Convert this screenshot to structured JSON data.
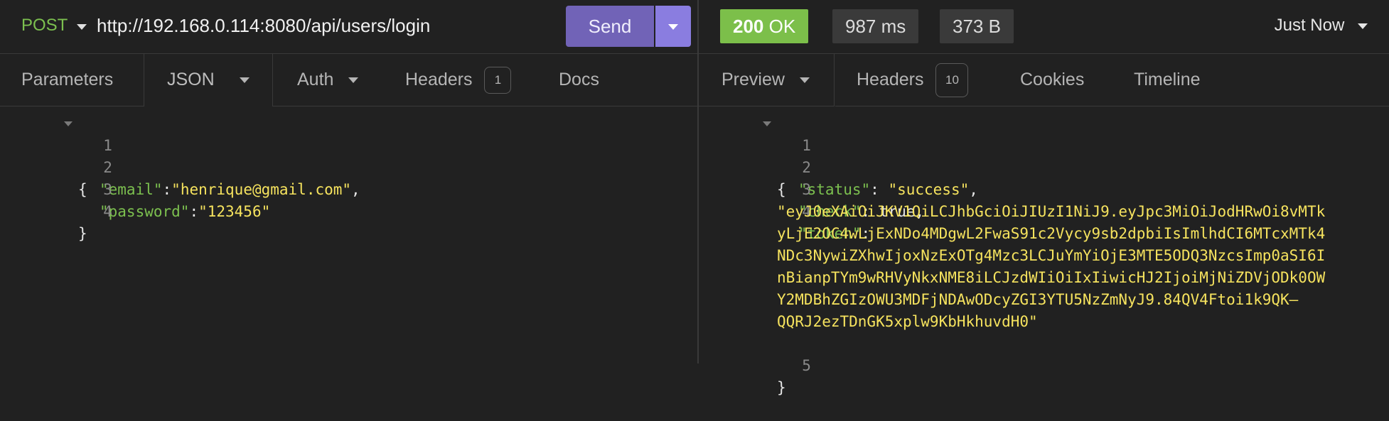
{
  "request": {
    "method": "POST",
    "url": "http://192.168.0.114:8080/api/users/login",
    "send_label": "Send",
    "tabs": [
      {
        "label": "Parameters"
      },
      {
        "label": "JSON"
      },
      {
        "label": "Auth"
      },
      {
        "label": "Headers",
        "badge": "1"
      },
      {
        "label": "Docs"
      }
    ],
    "body_lines": [
      {
        "num": "1",
        "text": "{"
      },
      {
        "num": "2",
        "key": "\"email\"",
        "sep": ":",
        "value": "\"henrique@gmail.com\"",
        "end": ","
      },
      {
        "num": "3",
        "key": "\"password\"",
        "sep": ":",
        "value": "\"123456\"",
        "end": ""
      },
      {
        "num": "4",
        "text": "}"
      }
    ]
  },
  "response": {
    "status_code": "200",
    "status_text": "OK",
    "time": "987 ms",
    "size": "373 B",
    "history_label": "Just Now",
    "status_color": "#7cbf4a",
    "tabs": [
      {
        "label": "Preview"
      },
      {
        "label": "Headers",
        "badge": "10"
      },
      {
        "label": "Cookies"
      },
      {
        "label": "Timeline"
      }
    ],
    "body_lines": [
      {
        "num": "1",
        "text": "{"
      },
      {
        "num": "2",
        "key": "\"status\"",
        "sep": ": ",
        "value": "\"success\"",
        "end": ","
      },
      {
        "num": "3",
        "key": "\"check\"",
        "sep": ": ",
        "value": "true",
        "end": ","
      },
      {
        "num": "4",
        "key": "\"token\"",
        "sep": ":"
      },
      {
        "num": "5",
        "text": "}"
      }
    ],
    "token_lines": [
      "\"eyJ0eXAiOiJKV1QiLCJhbGciOiJIUzI1NiJ9.eyJpc3MiOiJodHRwOi8vMTk",
      "yLjE2OC4wLjExNDo4MDgwL2FwaS91c2Vycy9sb2dpbiIsImlhdCI6MTcxMTk4",
      "NDc3NywiZXhwIjoxNzExOTg4Mzc3LCJuYmYiOjE3MTE5ODQ3NzcsImp0aSI6I",
      "nBianpTYm9wRHVyNkxNME8iLCJzdWIiOiIxIiwicHJ2IjoiMjNiZDVjODk0OW",
      "Y2MDBhZGIzOWU3MDFjNDAwODcyZGI3YTU5NzZmNyJ9.84QV4Ftoi1k9QK–",
      "QQRJ2ezTDnGK5xplw9KbHkhuvdH0\""
    ]
  }
}
